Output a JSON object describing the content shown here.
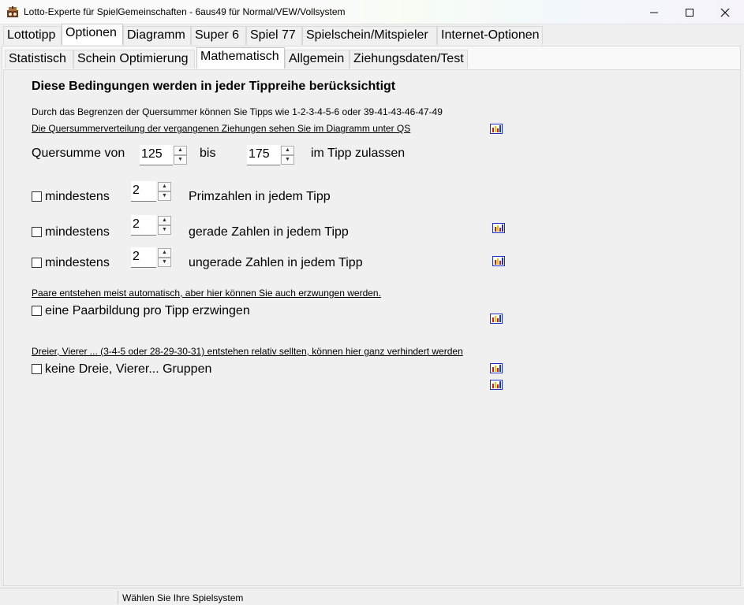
{
  "window": {
    "title": "Lotto-Experte für SpielGemeinschaften - 6aus49 für Normal/VEW/Vollsystem",
    "minimize_icon": "minimize-icon",
    "maximize_icon": "maximize-icon",
    "close_icon": "close-icon"
  },
  "main_tabs": [
    {
      "label": "Lottotipp"
    },
    {
      "label": "Optionen",
      "active": true
    },
    {
      "label": "Diagramm"
    },
    {
      "label": "Super 6"
    },
    {
      "label": "Spiel 77"
    },
    {
      "label": "Spielschein/Mitspieler"
    },
    {
      "label": "Internet-Optionen"
    }
  ],
  "sub_tabs": [
    {
      "label": "Statistisch"
    },
    {
      "label": "Schein Optimierung"
    },
    {
      "label": "Mathematisch",
      "active": true
    },
    {
      "label": "Allgemein"
    },
    {
      "label": "Ziehungsdaten/Test"
    }
  ],
  "content": {
    "heading": "Diese Bedingungen werden in jeder Tippreihe berücksichtigt",
    "qs_info": "Durch das Begrenzen der Quersummer können Sie Tipps wie 1-2-3-4-5-6 oder 39-41-43-46-47-49",
    "qs_link": "Die Quersummerverteilung der vergangenen Ziehungen sehen Sie im Diagramm unter QS ",
    "qs_from_label": "Quersumme von",
    "qs_from_value": "125",
    "qs_to_label": "bis",
    "qs_to_value": "175",
    "qs_suffix": "im Tipp zulassen",
    "min_label": "mindestens",
    "prime_value": "2",
    "prime_suffix": "Primzahlen in jedem Tipp",
    "even_value": "2",
    "even_suffix": "gerade Zahlen in jedem Tipp",
    "odd_value": "2",
    "odd_suffix": "ungerade Zahlen in jedem Tipp",
    "pairs_link": "Paare entstehen meist automatisch, aber hier können Sie auch erzwungen werden.",
    "pairs_checkbox": "eine Paarbildung pro Tipp erzwingen",
    "groups_link": "Dreier,  Vierer ... (3-4-5  oder 28-29-30-31) entstehen relativ sellten, können hier ganz verhindert werden",
    "groups_checkbox": "keine Dreie, Vierer... Gruppen",
    "spin_up": "▲",
    "spin_down": "▼"
  },
  "statusbar": {
    "text": "Wählen Sie Ihre Spielsystem"
  },
  "colors": {
    "icon_red": "#d21a1a",
    "icon_blue": "#1a2fd2",
    "icon_yellow": "#f2c200"
  }
}
